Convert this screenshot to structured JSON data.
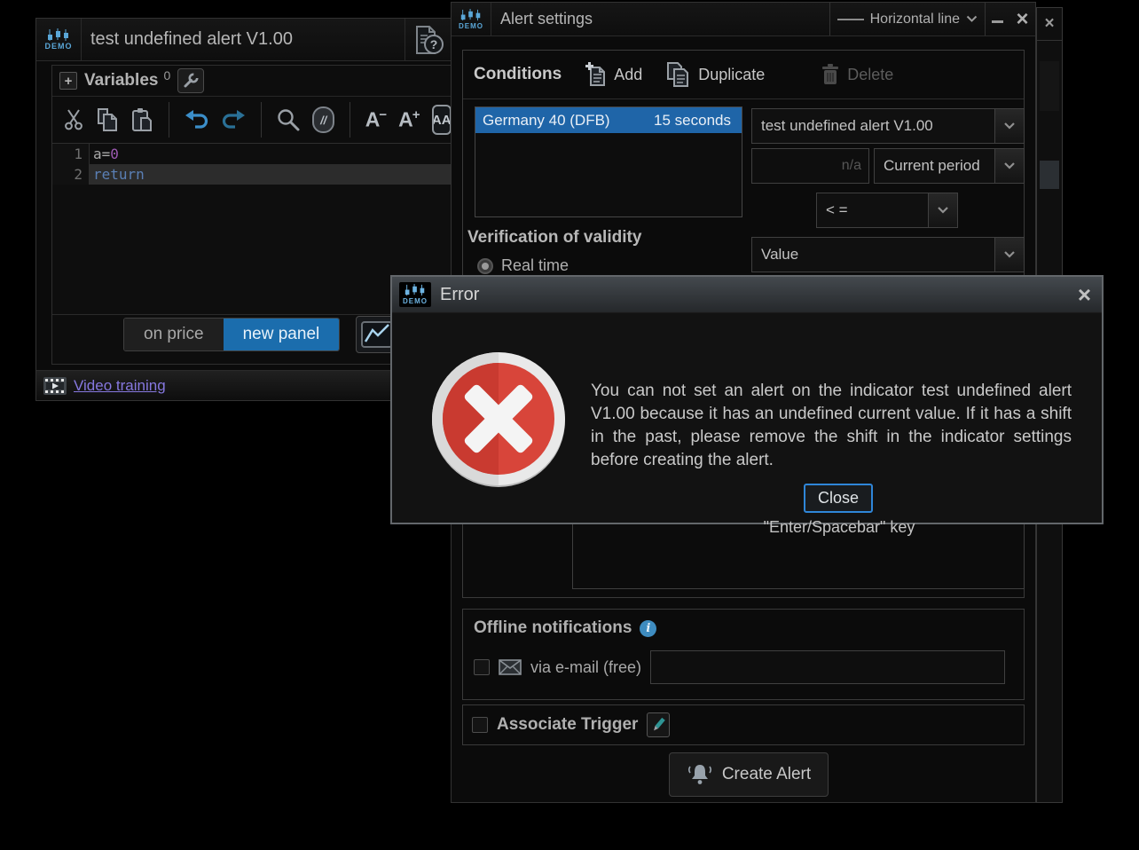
{
  "colors": {
    "selection_blue": "#1f65a8",
    "button_blue": "#1b6dad",
    "close_border_blue": "#2f86d8",
    "error_red": "#cd3a31",
    "link_purple": "#8678e0",
    "demo_blue": "#5aa7d8"
  },
  "editor_window": {
    "logo_text": "DEMO",
    "title": "test undefined alert V1.00",
    "variables": {
      "label": "Variables",
      "count": "0"
    },
    "toolbar": {
      "comment_glyph": "//",
      "font_smaller_letter": "A",
      "font_smaller_sign": "−",
      "font_larger_letter": "A",
      "font_larger_sign": "+",
      "font_toggle": "AA"
    },
    "code": {
      "line1": {
        "num": "1",
        "pre": "a=",
        "value": "0"
      },
      "line2": {
        "num": "2",
        "keyword": "return"
      }
    },
    "panel_buttons": {
      "on_price": "on price",
      "new_panel": "new panel"
    },
    "video_training_label": "Video training"
  },
  "alert_window": {
    "logo_text": "DEMO",
    "title": "Alert settings",
    "object_selector_label": "Horizontal line",
    "minimize_glyph": "",
    "close_glyph": "×",
    "conditions": {
      "header": "Conditions",
      "add_label": "Add",
      "duplicate_label": "Duplicate",
      "delete_label": "Delete",
      "list": [
        {
          "instrument": "Germany 40 (DFB)",
          "timeframe": "15 seconds"
        }
      ],
      "indicator_value": "test undefined alert V1.00",
      "na_placeholder": "n/a",
      "period_value": "Current period",
      "operator_value": "< =",
      "validity_header": "Verification of validity",
      "realtime_label": "Real time",
      "target_value": "Value"
    },
    "offline": {
      "header": "Offline notifications",
      "email_label": "via e-mail (free)",
      "email_value": ""
    },
    "trigger_label": "Associate Trigger",
    "create_alert_label": "Create Alert"
  },
  "background_window": {
    "close_glyph": "×"
  },
  "error_dialog": {
    "logo_text": "DEMO",
    "title": "Error",
    "close_glyph": "×",
    "message": "You can not set an alert on the indicator test undefined alert V1.00 because it has an undefined current value. If it has a shift in the past, please remove the shift in the indicator settings before creating the alert.",
    "close_label": "Close",
    "hint": "\"Enter/Spacebar\" key"
  }
}
